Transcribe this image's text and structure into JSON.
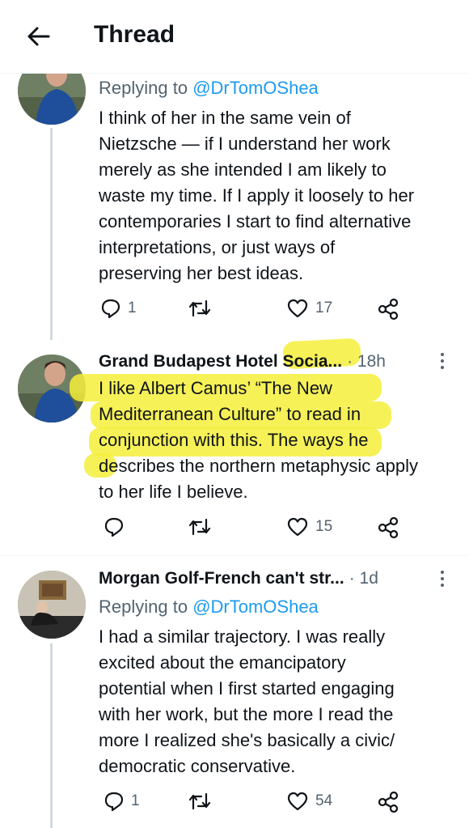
{
  "header": {
    "title": "Thread"
  },
  "tweets": [
    {
      "reply_prefix": "Replying to ",
      "reply_handle": "@DrTomOShea",
      "lines": [
        "I think of her in the same vein of",
        "Nietzsche — if I understand her work",
        "merely as she intended I am likely to",
        "waste my time. If I apply it loosely to her",
        "contemporaries I start to find alternative",
        "interpretations, or just ways of",
        "preserving her best ideas."
      ],
      "replies": "1",
      "retweets": "",
      "likes": "17"
    },
    {
      "name": "Grand Budapest Hotel Socia...",
      "time": "· 18h",
      "lines": [
        "I like Albert Camus’ “The New",
        "Mediterranean Culture” to read in",
        "conjunction with this. The ways he",
        "describes the northern metaphysic apply",
        "to her life I believe."
      ],
      "replies": "",
      "retweets": "",
      "likes": "15"
    },
    {
      "name": "Morgan Golf-French can't str...",
      "time": "· 1d",
      "reply_prefix": "Replying to ",
      "reply_handle": "@DrTomOShea",
      "lines": [
        "I had a similar trajectory. I was really",
        "excited about the emancipatory",
        "potential when I first started engaging",
        "with her work, but the more I read the",
        "more I realized she's basically a civic/",
        "democratic conservative."
      ],
      "replies": "1",
      "retweets": "",
      "likes": "54"
    }
  ],
  "icons": {
    "back": "arrow-left-icon",
    "reply": "reply-icon",
    "retweet": "retweet-icon",
    "like": "heart-icon",
    "share": "share-icon",
    "more": "more-vertical-icon"
  },
  "colors": {
    "accent": "#1d9bf0",
    "muted": "#536471",
    "highlight": "#f4ef3a"
  }
}
